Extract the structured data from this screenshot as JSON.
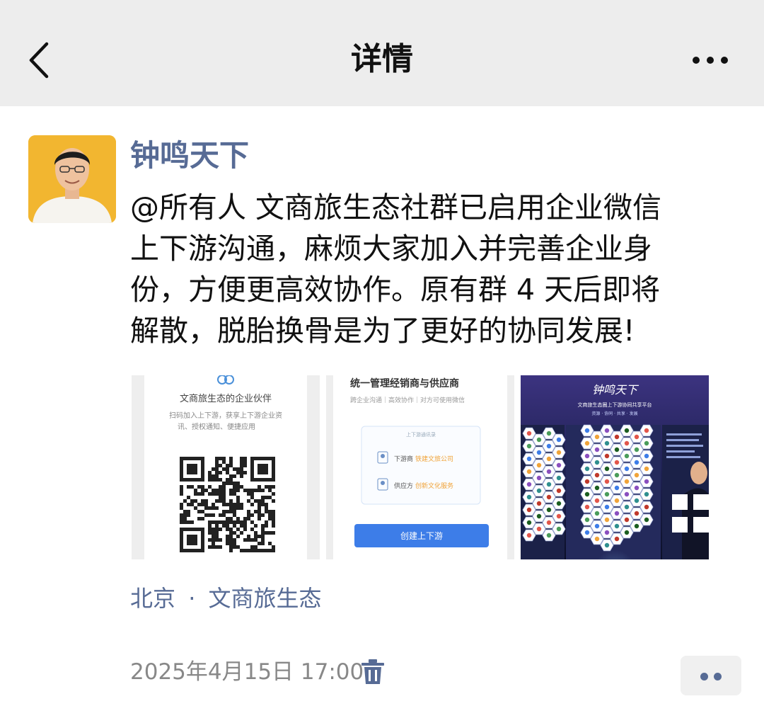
{
  "header": {
    "title": "详情"
  },
  "post": {
    "author": "钟鸣天下",
    "text_lines": [
      "@所有人 文商旅生态社群已启用企业微信",
      "上下游沟通，麻烦大家加入并完善企业身",
      "份，方便更高效协作。原有群 4 天后即将",
      "解散，脱胎换骨是为了更好的协同发展!"
    ],
    "images": [
      {
        "heading": "文商旅生态的企业伙伴",
        "desc_line1": "扫码加入上下游，获享上下游企业资",
        "desc_line2": "讯、授权通知、便捷应用"
      },
      {
        "heading": "统一管理经销商与供应商",
        "subheading": "跨企业沟通｜高效协作｜对方可使用微信",
        "card_title": "上下游通讯录",
        "row1_label": "下游商",
        "row1_value": "铁建文旅公司",
        "row2_label": "供应方",
        "row2_value": "创新文化服务",
        "button": "创建上下游"
      },
      {
        "banner_title": "钟鸣天下",
        "banner_subtitle": "文商旅生态圈上下游协同共享平台",
        "banner_tagline": "资源 · 协同 · 共享 · 发展"
      }
    ],
    "location": "北京",
    "separator": "·",
    "topic": "文商旅生态",
    "timestamp": "2025年4月15日 17:00"
  },
  "colors": {
    "link": "#576b95",
    "header_bg": "#ededed",
    "wecom_button": "#3d7de8"
  },
  "icons": [
    "back-arrow-icon",
    "more-dots-icon",
    "trash-icon",
    "more-dots-icon"
  ]
}
